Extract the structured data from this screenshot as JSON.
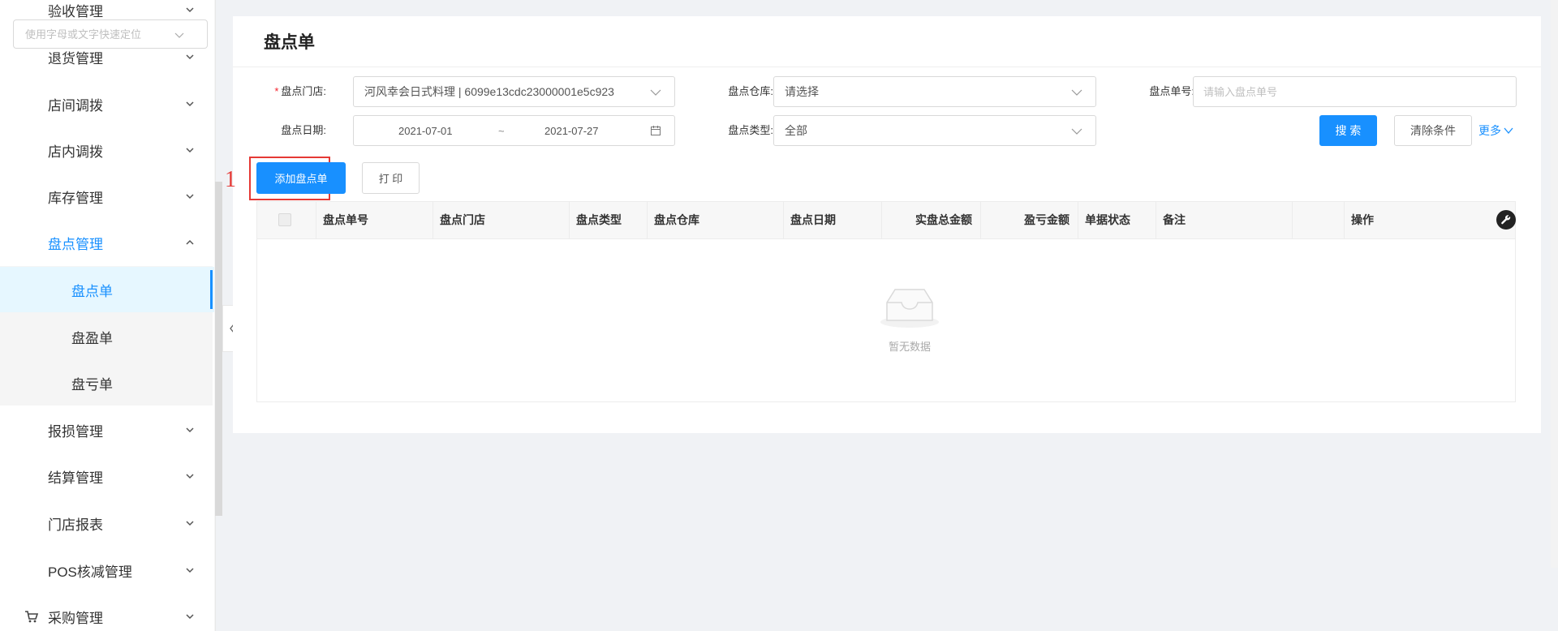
{
  "sidebar": {
    "quick_search_placeholder": "使用字母或文字快速定位",
    "items": [
      {
        "label": "验收管理"
      },
      {
        "label": "退货管理"
      },
      {
        "label": "店间调拨"
      },
      {
        "label": "店内调拨"
      },
      {
        "label": "库存管理"
      },
      {
        "label": "盘点管理"
      },
      {
        "label": "报损管理"
      },
      {
        "label": "结算管理"
      },
      {
        "label": "门店报表"
      },
      {
        "label": "POS核减管理"
      },
      {
        "label": "采购管理"
      }
    ],
    "subitems": [
      {
        "label": "盘点单"
      },
      {
        "label": "盘盈单"
      },
      {
        "label": "盘亏单"
      }
    ]
  },
  "page": {
    "title": "盘点单"
  },
  "filters": {
    "store_label": "盘点门店:",
    "store_value": "河风幸会日式料理 | 6099e13cdc23000001e5c923",
    "warehouse_label": "盘点仓库:",
    "warehouse_placeholder": "请选择",
    "order_no_label": "盘点单号:",
    "order_no_placeholder": "请输入盘点单号",
    "date_label": "盘点日期:",
    "date_start": "2021-07-01",
    "date_sep": "~",
    "date_end": "2021-07-27",
    "type_label": "盘点类型:",
    "type_value": "全部",
    "search_button": "搜 索",
    "clear_button": "清除条件",
    "more_link": "更多"
  },
  "actions": {
    "add_button": "添加盘点单",
    "print_button": "打 印",
    "step_number": "1"
  },
  "table": {
    "columns": [
      "盘点单号",
      "盘点门店",
      "盘点类型",
      "盘点仓库",
      "盘点日期",
      "实盘总金额",
      "盈亏金额",
      "单据状态",
      "备注",
      "操作"
    ],
    "empty_text": "暂无数据"
  },
  "colors": {
    "primary": "#1890ff",
    "highlight": "#e53935"
  }
}
